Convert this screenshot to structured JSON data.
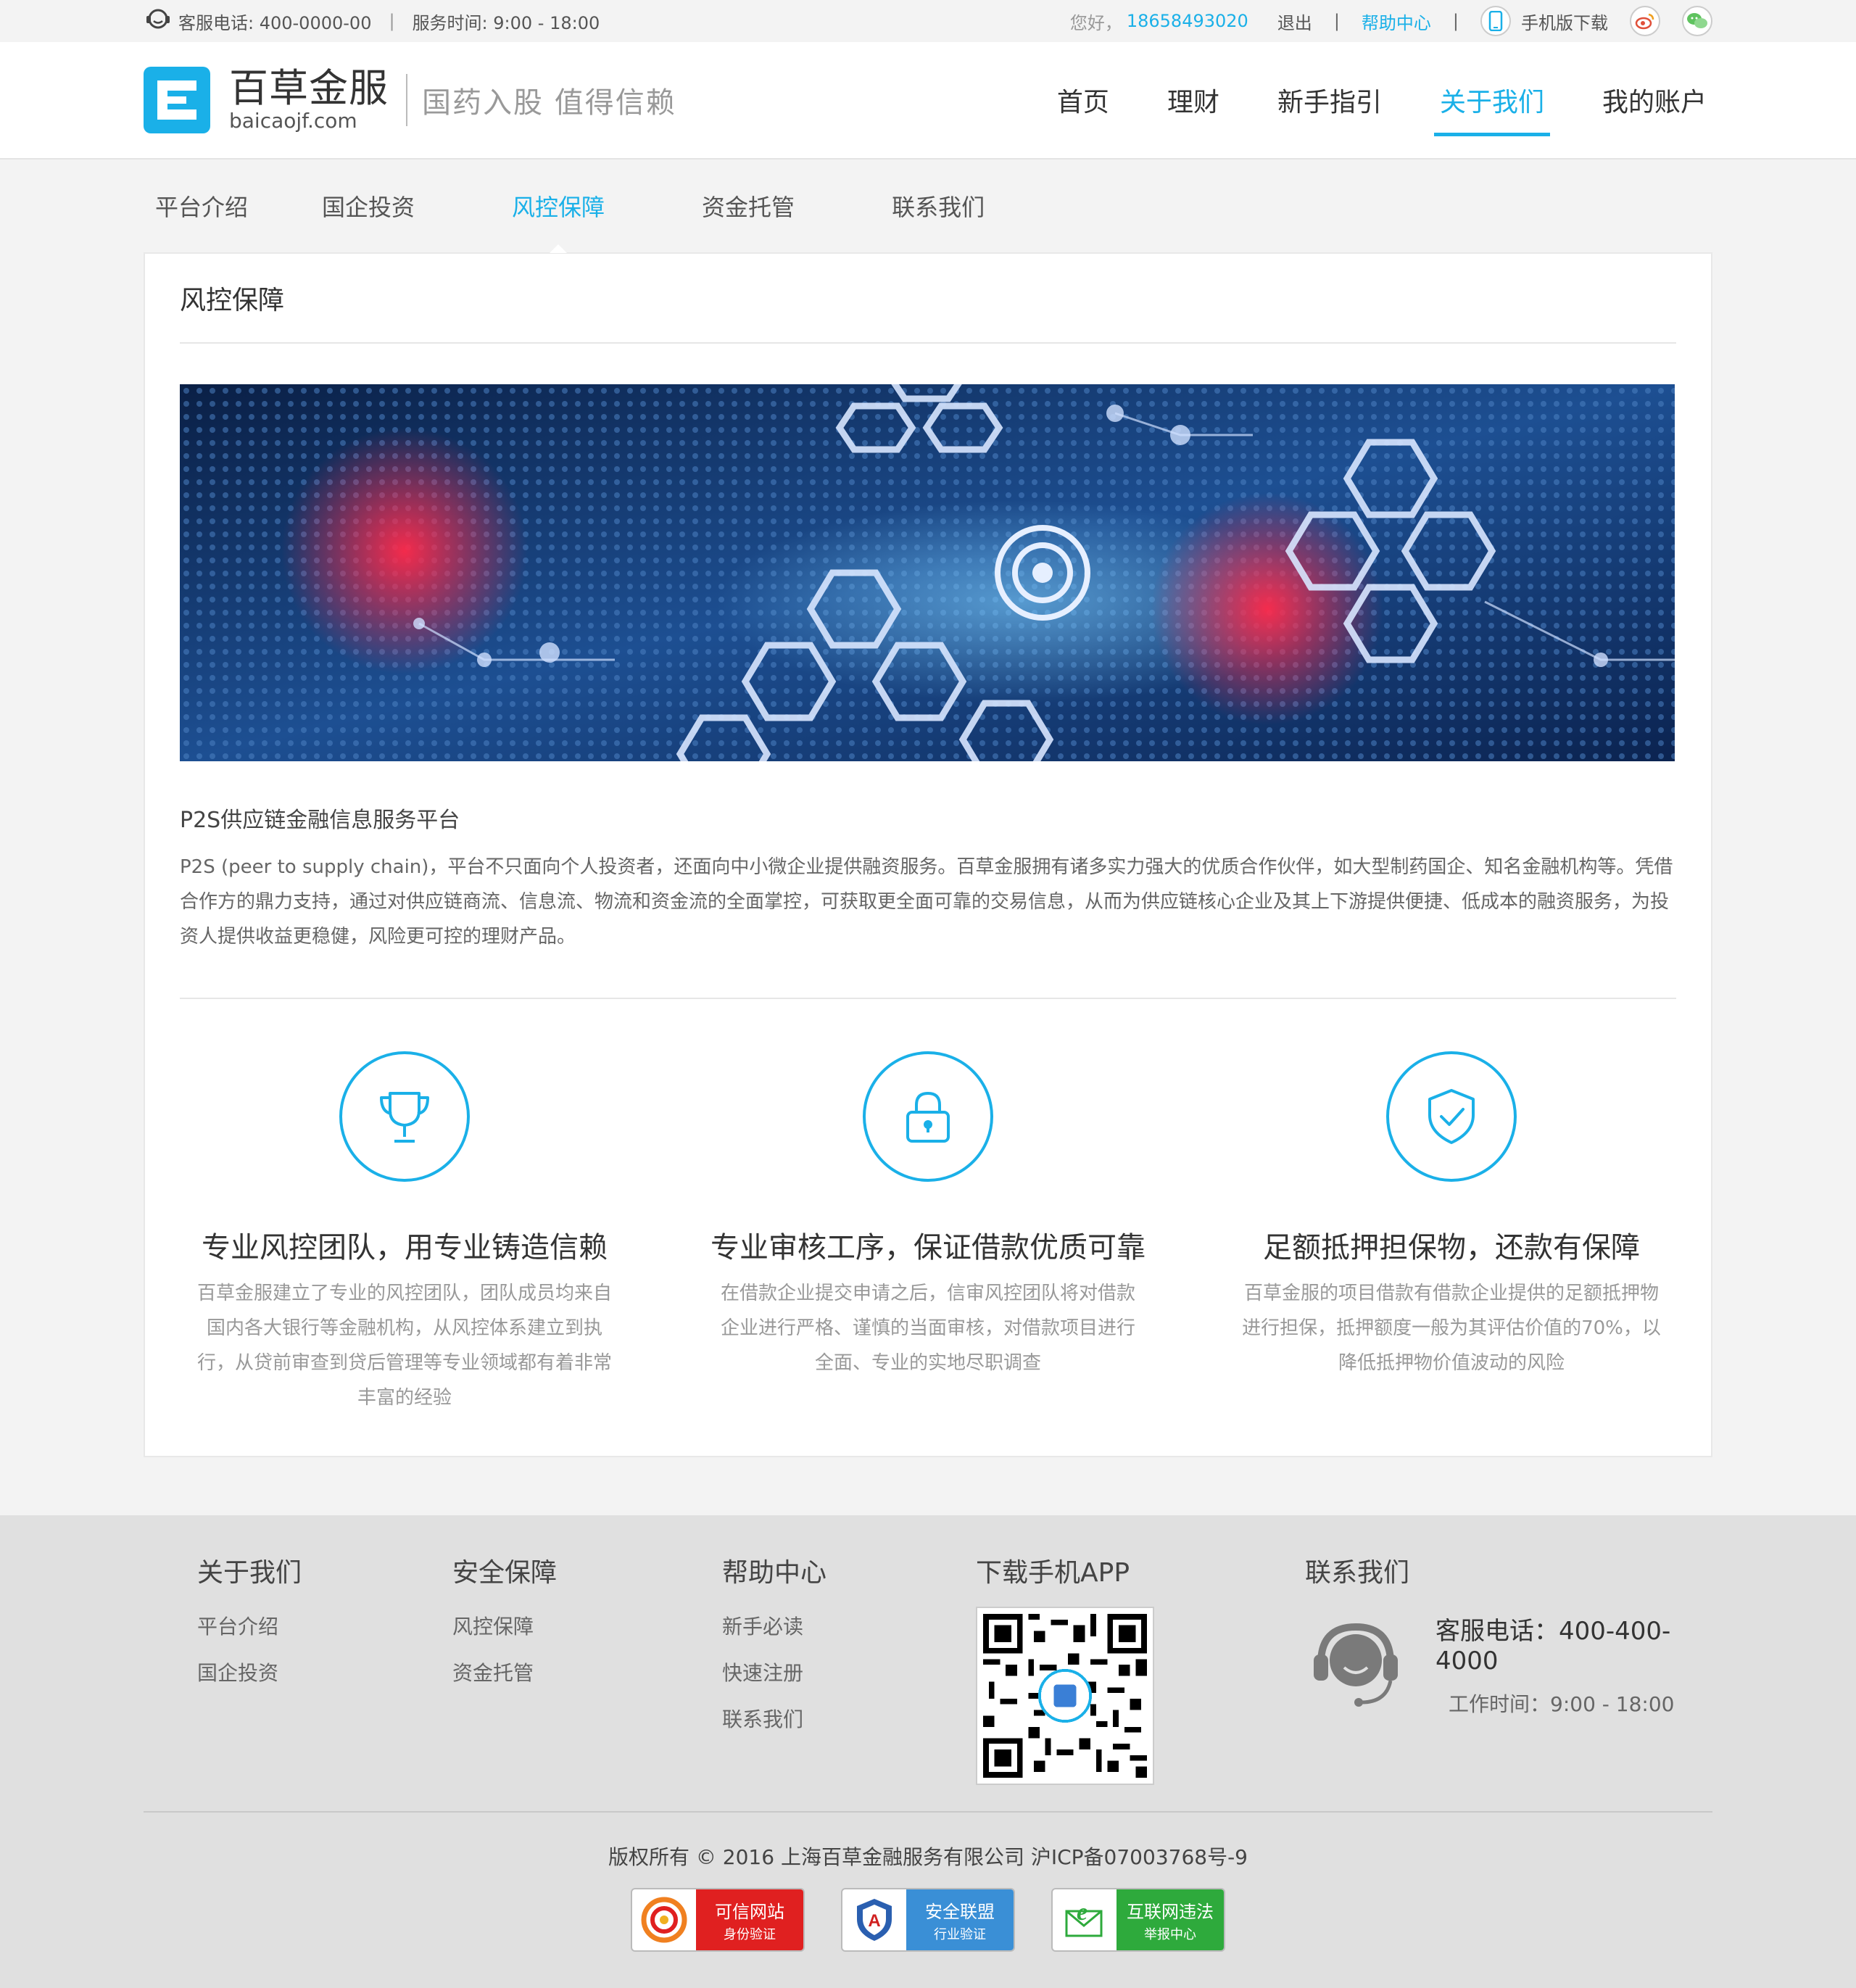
{
  "topbar": {
    "service_phone": "客服电话: 400-0000-00",
    "service_hours": "服务时间: 9:00 - 18:00",
    "greeting": "您好，",
    "username": "18658493020",
    "logout": "退出",
    "help": "帮助中心",
    "mobile_download": "手机版下载",
    "icons": [
      "headset-icon",
      "phone-icon",
      "weibo-icon",
      "wechat-icon"
    ]
  },
  "header": {
    "logo_cn": "百草金服",
    "logo_en": "baicaojf.com",
    "slogan": "国药入股  值得信赖",
    "nav": [
      {
        "label": "首页",
        "active": false
      },
      {
        "label": "理财",
        "active": false
      },
      {
        "label": "新手指引",
        "active": false
      },
      {
        "label": "关于我们",
        "active": true
      },
      {
        "label": "我的账户",
        "active": false
      }
    ]
  },
  "subnav": [
    {
      "label": "平台介绍",
      "active": false
    },
    {
      "label": "国企投资",
      "active": false
    },
    {
      "label": "风控保障",
      "active": true
    },
    {
      "label": "资金托管",
      "active": false
    },
    {
      "label": "联系我们",
      "active": false
    }
  ],
  "content": {
    "title": "风控保障",
    "intro_title": "P2S供应链金融信息服务平台",
    "intro_text": "P2S (peer to supply chain)，平台不只面向个人投资者，还面向中小微企业提供融资服务。百草金服拥有诸多实力强大的优质合作伙伴，如大型制药国企、知名金融机构等。凭借合作方的鼎力支持，通过对供应链商流、信息流、物流和资金流的全面掌控，可获取更全面可靠的交易信息，从而为供应链核心企业及其上下游提供便捷、低成本的融资服务，为投资人提供收益更稳健，风险更可控的理财产品。",
    "features": [
      {
        "icon": "trophy-icon",
        "title": "专业风控团队，用专业铸造信赖",
        "text": "百草金服建立了专业的风控团队，团队成员均来自国内各大银行等金融机构，从风控体系建立到执行，从贷前审查到贷后管理等专业领域都有着非常丰富的经验"
      },
      {
        "icon": "lock-icon",
        "title": "专业审核工序，保证借款优质可靠",
        "text": "在借款企业提交申请之后，信审风控团队将对借款企业进行严格、谨慎的当面审核，对借款项目进行全面、专业的实地尽职调查"
      },
      {
        "icon": "shield-icon",
        "title": "足额抵押担保物，还款有保障",
        "text": "百草金服的项目借款有借款企业提供的足额抵押物进行担保，抵押额度一般为其评估价值的70%，以降低抵押物价值波动的风险"
      }
    ]
  },
  "footer": {
    "about": {
      "title": "关于我们",
      "links": [
        "平台介绍",
        "国企投资"
      ]
    },
    "security": {
      "title": "安全保障",
      "links": [
        "风控保障",
        "资金托管"
      ]
    },
    "help": {
      "title": "帮助中心",
      "links": [
        "新手必读",
        "快速注册",
        "联系我们"
      ]
    },
    "app": {
      "title": "下载手机APP"
    },
    "contact": {
      "title": "联系我们",
      "phone": "客服电话：400-400-4000",
      "hours": "工作时间：9:00 - 18:00"
    },
    "copyright": "版权所有 © 2016 上海百草金融服务有限公司    沪ICP备07003768号-9",
    "badges": [
      {
        "line1": "可信网站",
        "line2": "身份验证",
        "color": "#e02020"
      },
      {
        "line1": "安全联盟",
        "line2": "行业验证",
        "color": "#3a8fd6"
      },
      {
        "line1": "互联网违法",
        "line2": "举报中心",
        "color": "#2eaa3c"
      }
    ]
  },
  "colors": {
    "accent": "#1ab0e8",
    "footer_bg": "#e0e0e0",
    "page_bg": "#f3f3f3"
  }
}
